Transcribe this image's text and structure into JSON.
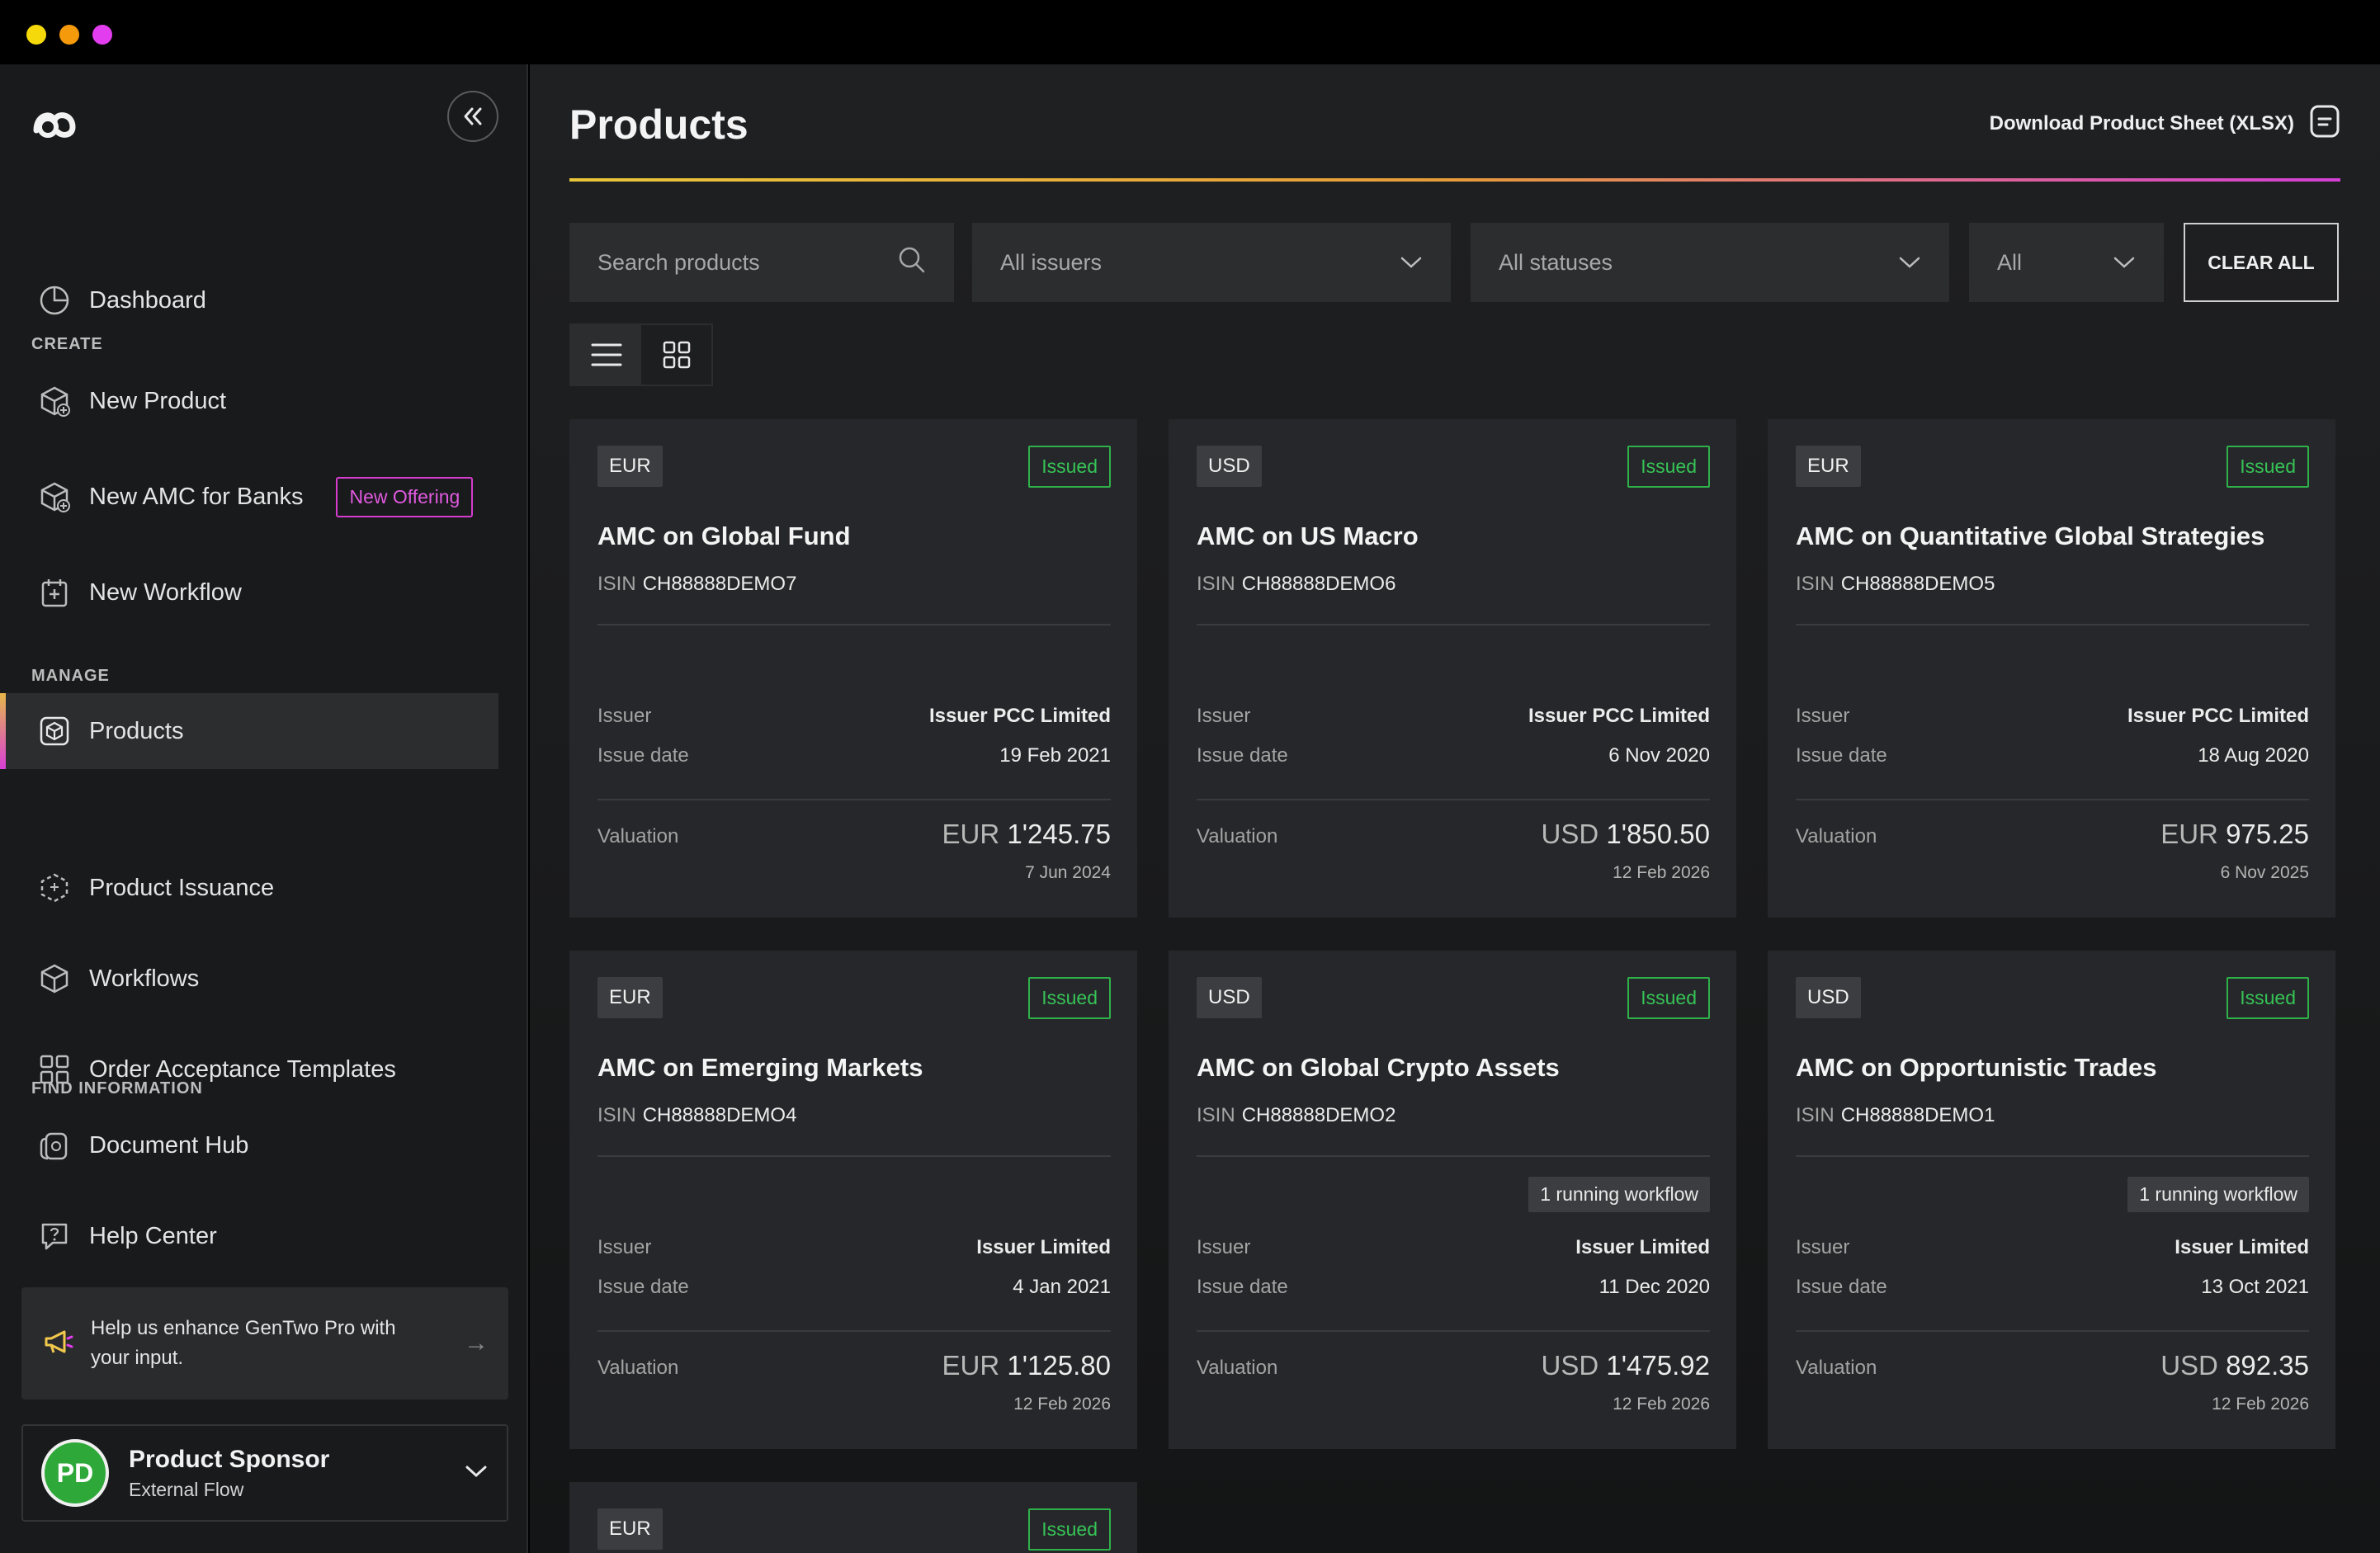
{
  "window": {
    "controls": [
      "close",
      "minimize",
      "maximize"
    ]
  },
  "sidebar": {
    "logo_icon": "gentwo-logo-icon",
    "dashboard": "Dashboard",
    "section_create": "CREATE",
    "new_product": "New Product",
    "new_amc": "New AMC for Banks",
    "new_amc_badge": "New Offering",
    "new_workflow": "New Workflow",
    "section_manage": "MANAGE",
    "products": "Products",
    "product_issuance": "Product Issuance",
    "workflows": "Workflows",
    "order_templates": "Order Acceptance Templates",
    "section_find": "FIND INFORMATION",
    "document_hub": "Document Hub",
    "help_center": "Help Center",
    "feedback": "Help us enhance GenTwo Pro with your input.",
    "user": {
      "initials": "PD",
      "name": "Product Sponsor",
      "role": "External Flow"
    }
  },
  "header": {
    "title": "Products",
    "download": "Download Product Sheet (XLSX)"
  },
  "filters": {
    "search_placeholder": "Search products",
    "issuers": "All issuers",
    "statuses": "All statuses",
    "type": "All",
    "clear": "CLEAR ALL"
  },
  "view": {
    "mode": "list"
  },
  "colors": {
    "accent_start": "#e8c53a",
    "accent_end": "#d43fd6",
    "status_green": "#36c456",
    "badge_magenta": "#d63ccf"
  },
  "labels": {
    "isin": "ISIN",
    "issuer": "Issuer",
    "issue_date": "Issue date",
    "valuation": "Valuation"
  },
  "products": [
    {
      "currency": "EUR",
      "status": "Issued",
      "name": "AMC on Global Fund",
      "isin": "CH88888DEMO7",
      "workflow": "",
      "issuer": "Issuer PCC Limited",
      "issue_date": "19 Feb 2021",
      "val_ccy": "EUR",
      "val_amount": "1'245.75",
      "val_date": "7 Jun 2024"
    },
    {
      "currency": "USD",
      "status": "Issued",
      "name": "AMC on US Macro",
      "isin": "CH88888DEMO6",
      "workflow": "",
      "issuer": "Issuer PCC Limited",
      "issue_date": "6 Nov 2020",
      "val_ccy": "USD",
      "val_amount": "1'850.50",
      "val_date": "12 Feb 2026"
    },
    {
      "currency": "EUR",
      "status": "Issued",
      "name": "AMC on Quantitative Global Strategies",
      "isin": "CH88888DEMO5",
      "workflow": "",
      "issuer": "Issuer PCC Limited",
      "issue_date": "18 Aug 2020",
      "val_ccy": "EUR",
      "val_amount": "975.25",
      "val_date": "6 Nov 2025"
    },
    {
      "currency": "EUR",
      "status": "Issued",
      "name": "AMC on Emerging Markets",
      "isin": "CH88888DEMO4",
      "workflow": "",
      "issuer": "Issuer Limited",
      "issue_date": "4 Jan 2021",
      "val_ccy": "EUR",
      "val_amount": "1'125.80",
      "val_date": "12 Feb 2026"
    },
    {
      "currency": "USD",
      "status": "Issued",
      "name": "AMC on Global Crypto Assets",
      "isin": "CH88888DEMO2",
      "workflow": "1  running workflow",
      "issuer": "Issuer Limited",
      "issue_date": "11 Dec 2020",
      "val_ccy": "USD",
      "val_amount": "1'475.92",
      "val_date": "12 Feb 2026"
    },
    {
      "currency": "USD",
      "status": "Issued",
      "name": "AMC on Opportunistic Trades",
      "isin": "CH88888DEMO1",
      "workflow": "1  running workflow",
      "issuer": "Issuer Limited",
      "issue_date": "13 Oct 2021",
      "val_ccy": "USD",
      "val_amount": "892.35",
      "val_date": "12 Feb 2026"
    },
    {
      "currency": "EUR",
      "status": "Issued"
    }
  ]
}
